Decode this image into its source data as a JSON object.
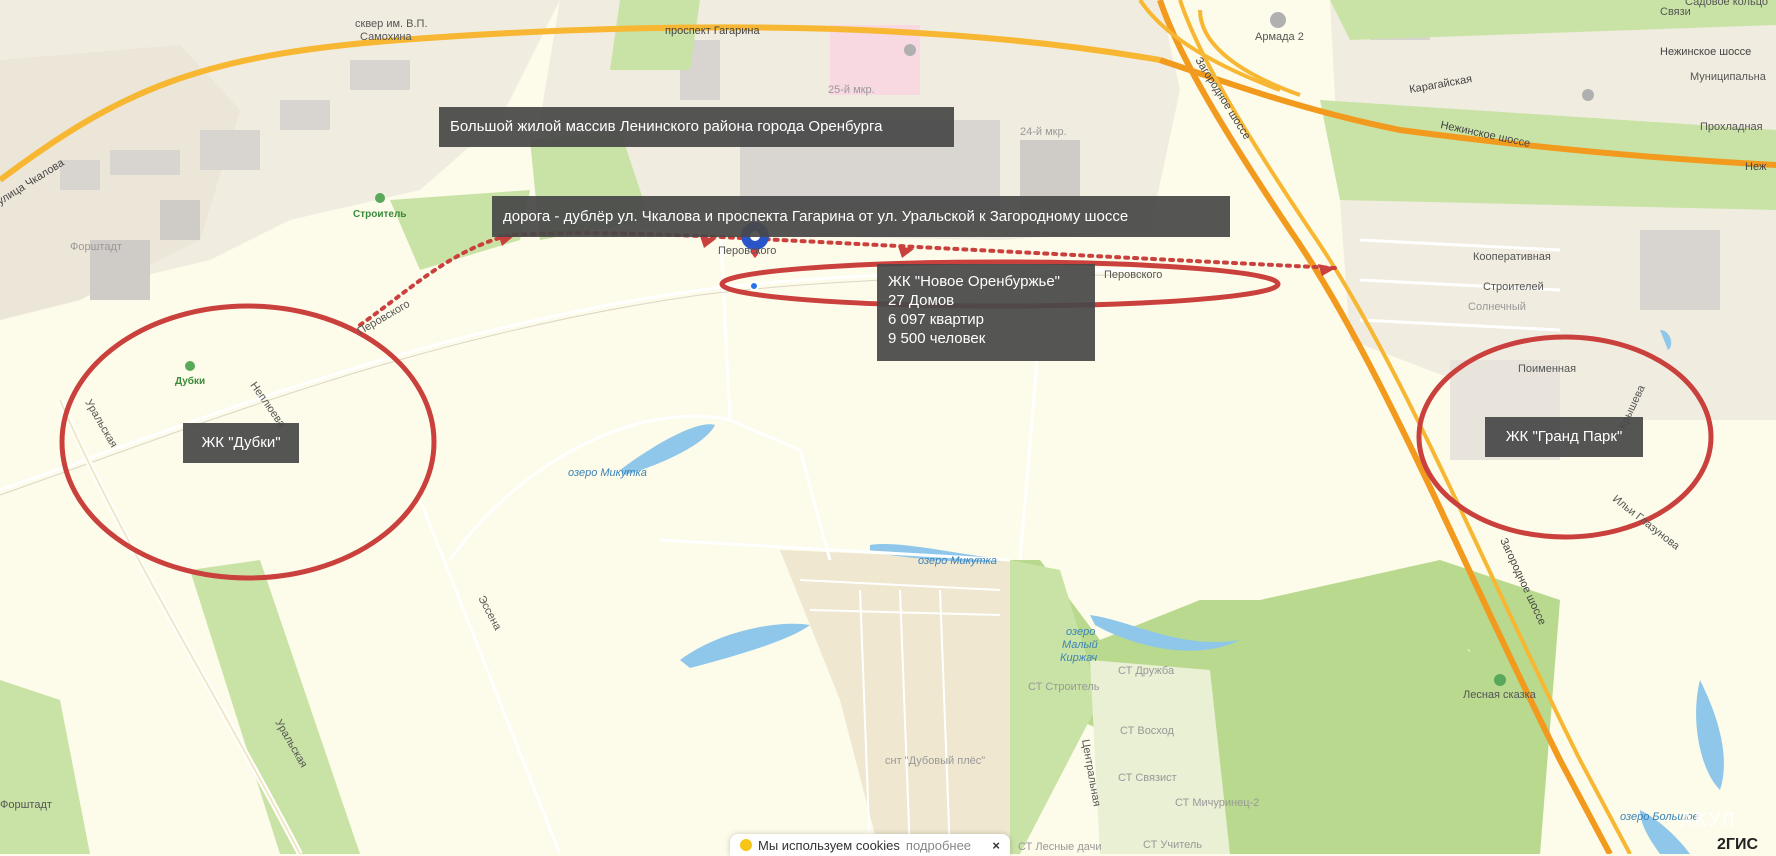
{
  "callouts": {
    "title": "Большой жилой массив Ленинского района города Оренбурга",
    "road": "дорога - дублёр ул. Чкалова и проспекта Гагарина от ул. Уральской к Загородному шоссе",
    "dubki": "ЖК \"Дубки\"",
    "grand_park": "ЖК \"Гранд Парк\"",
    "novoe": {
      "name": "ЖК \"Новое Оренбуржье\"",
      "houses": "27 Домов",
      "flats": "6 097 квартир",
      "people": "9 500 человек"
    }
  },
  "labels": {
    "prospekt_gagarina": "проспект Гагарина",
    "skver_1": "сквер им. В.П.",
    "skver_2": "Самохина",
    "ulitsa_chkalova": "улица Чкалова",
    "stroitel": "Строитель",
    "forshtadt": "Форштадт",
    "forshtadt_2": "Форштадт",
    "mkr25": "25-й мкр.",
    "mkr24": "24-й мкр.",
    "zagorodnoe_top": "Загородное шоссе",
    "zagorodnoe_bottom": "Загородное шоссе",
    "armada": "Армада 2",
    "karagayskaya": "Карагайская",
    "nezhinskoe": "Нежинское шоссе",
    "nezhinskoe_2": "Нежинское шоссе",
    "nezh_edge": "Неж",
    "svyazi": "Связи",
    "sadovoe": "Садовое кольцо",
    "munitsipalnaya": "Муниципальна",
    "prokhladnaya": "Прохладная",
    "kooperativnaya": "Кооперативная",
    "stroiteley": "Строителей",
    "solnechny": "Солнечный",
    "poymennaya": "Поименная",
    "peruvskogo_center": "Перовского",
    "perovskogo_right": "Перовского",
    "perovskogo_left": "Перовского",
    "dubki_park": "Дубки",
    "neplyueva": "Неплюева",
    "uralskaya_top": "Уральская",
    "uralskaya_bottom": "Уральская",
    "ozero_mikutka_1": "озеро Микутка",
    "ozero_mikutka_2": "озеро Микутка",
    "ozero_maly_1": "озеро",
    "ozero_maly_2": "Малый",
    "ozero_maly_3": "Киржач",
    "essena": "Эссена",
    "st_stroitel": "СТ Строитель",
    "st_druzhba": "СТ Дружба",
    "st_voskhod": "СТ Восход",
    "st_svyazist": "СТ Связист",
    "st_michurinets": "СТ Мичуринец-2",
    "st_uchitel": "СТ Учитель",
    "st_lesnye": "СТ Лесные дачи",
    "snt_dubovy": "снт \"Дубовый плёс\"",
    "tsentralnaya": "Центральная",
    "lesnaya_skazka": "Лесная сказка",
    "ozero_bolshoe": "озеро Большое",
    "ilyi_gruzova": "Ильи Глазунова",
    "krysheva": "Крышева"
  },
  "cookie": {
    "text": "Мы используем cookies",
    "more": "подробнее",
    "close": "×"
  },
  "brand": "2ГИС",
  "watermark": "АКУЛ",
  "colors": {
    "background": "#fdfbe9",
    "major_road": "#f7b733",
    "highway": "#f29a1e",
    "park": "#c9e3a6",
    "forest": "#b8d98e",
    "water": "#8fc7ea",
    "ellipse": "#c9403d",
    "dotted_route": "#c9403d",
    "callout_bg": "#484848"
  }
}
